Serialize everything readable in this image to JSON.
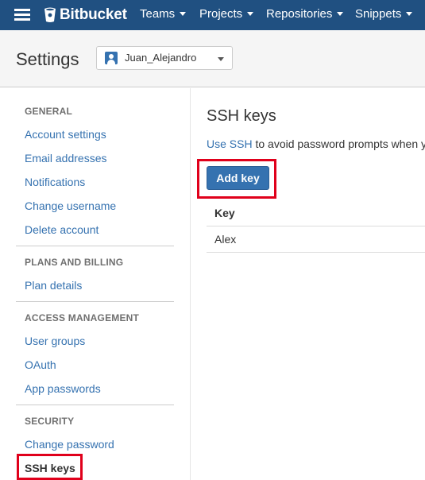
{
  "topbar": {
    "brand": "Bitbucket",
    "nav": [
      "Teams",
      "Projects",
      "Repositories",
      "Snippets"
    ],
    "colors": {
      "background": "#205081",
      "text": "#ffffff"
    }
  },
  "header": {
    "title": "Settings",
    "account": {
      "name": "Juan_Alejandro",
      "icon": "user-avatar-icon"
    }
  },
  "sidebar": {
    "sections": [
      {
        "heading": "GENERAL",
        "items": [
          "Account settings",
          "Email addresses",
          "Notifications",
          "Change username",
          "Delete account"
        ]
      },
      {
        "heading": "PLANS AND BILLING",
        "items": [
          "Plan details"
        ]
      },
      {
        "heading": "ACCESS MANAGEMENT",
        "items": [
          "User groups",
          "OAuth",
          "App passwords"
        ]
      },
      {
        "heading": "SECURITY",
        "items": [
          "Change password",
          "SSH keys"
        ]
      }
    ],
    "active_item": "SSH keys"
  },
  "main": {
    "title": "SSH keys",
    "intro_link": "Use SSH",
    "intro_text": " to avoid password prompts when y",
    "add_button": "Add key",
    "table": {
      "header": "Key",
      "rows": [
        "Alex"
      ]
    }
  },
  "colors": {
    "link": "#3572b0",
    "primary_button": "#3572b0",
    "highlight_box": "#e0001b"
  }
}
